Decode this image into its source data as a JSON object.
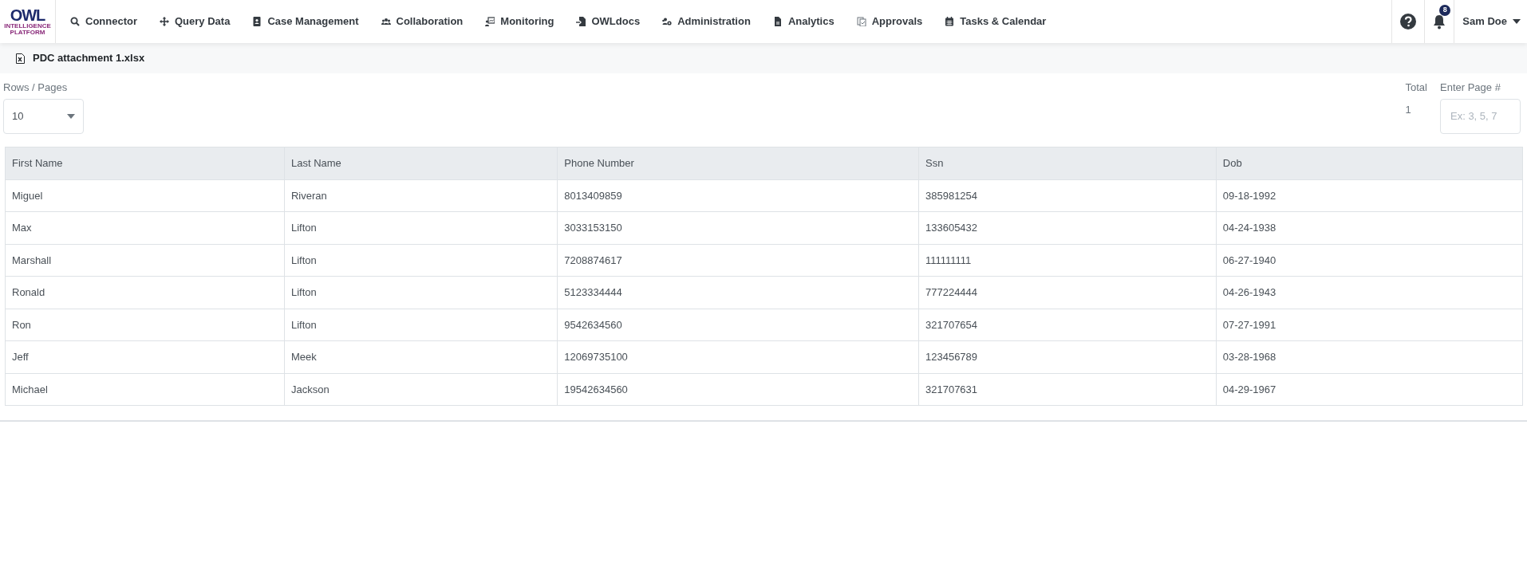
{
  "navbar": {
    "logo": {
      "text": "OWL",
      "subtext": "INTELLIGENCE PLATFORM"
    },
    "items": [
      {
        "label": "Connector"
      },
      {
        "label": "Query Data"
      },
      {
        "label": "Case Management"
      },
      {
        "label": "Collaboration"
      },
      {
        "label": "Monitoring"
      },
      {
        "label": "OWLdocs"
      },
      {
        "label": "Administration"
      },
      {
        "label": "Analytics"
      },
      {
        "label": "Approvals"
      },
      {
        "label": "Tasks & Calendar"
      }
    ],
    "notifications": {
      "count": "8"
    },
    "user": {
      "name": "Sam Doe"
    }
  },
  "breadcrumb": {
    "file": "PDC attachment 1.xlsx"
  },
  "rows_per_page": {
    "label": "Rows / Pages",
    "value": "10"
  },
  "total": {
    "label": "Total",
    "value": "1"
  },
  "page_input": {
    "label": "Enter Page #",
    "placeholder": "Ex: 3, 5, 7"
  },
  "table": {
    "columns": [
      "First Name",
      "Last Name",
      "Phone Number",
      "Ssn",
      "Dob"
    ],
    "rows": [
      [
        "Miguel",
        "Riveran",
        "8013409859",
        "385981254",
        "09-18-1992"
      ],
      [
        "Max",
        "Lifton",
        "3033153150",
        "133605432",
        "04-24-1938"
      ],
      [
        "Marshall",
        "Lifton",
        "7208874617",
        "111111111",
        "06-27-1940"
      ],
      [
        "Ronald",
        "Lifton",
        "5123334444",
        "777224444",
        "04-26-1943"
      ],
      [
        "Ron",
        "Lifton",
        "9542634560",
        "321707654",
        "07-27-1991"
      ],
      [
        "Jeff",
        "Meek",
        "12069735100",
        "123456789",
        "03-28-1968"
      ],
      [
        "Michael",
        "Jackson",
        "19542634560",
        "321707631",
        "04-29-1967"
      ]
    ]
  }
}
